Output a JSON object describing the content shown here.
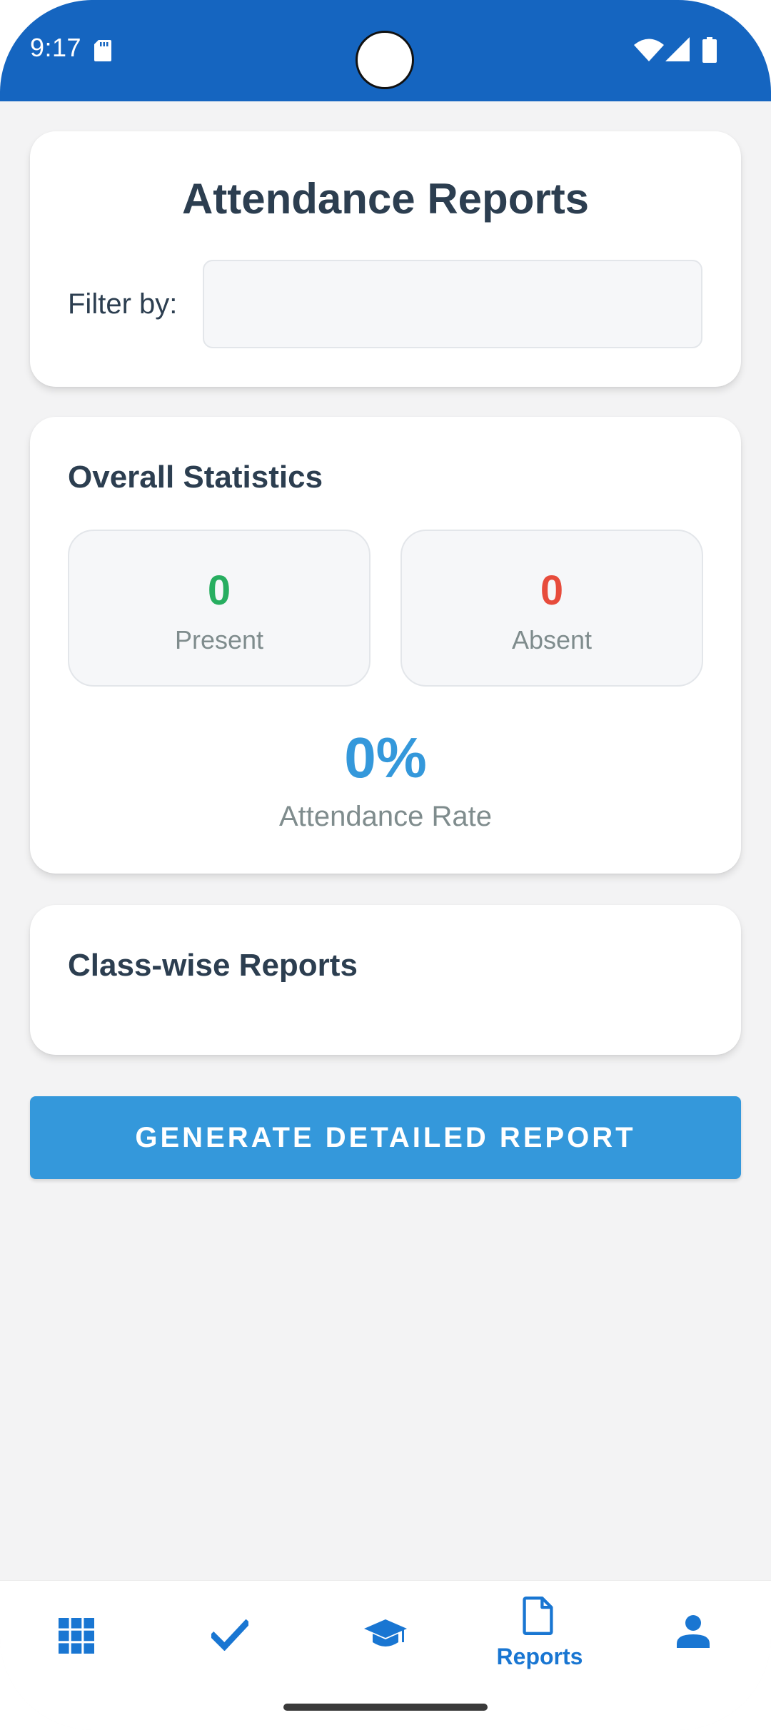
{
  "status_bar": {
    "time": "9:17",
    "background": "#1565c0",
    "icons": [
      "sd-card-icon",
      "camera-cutout",
      "wifi-icon",
      "cell-signal-icon",
      "battery-icon"
    ]
  },
  "header_card": {
    "title": "Attendance Reports",
    "filter_label": "Filter by:",
    "filter_value": ""
  },
  "stats_card": {
    "title": "Overall Statistics",
    "present": {
      "value": "0",
      "label": "Present",
      "color": "#27ae60"
    },
    "absent": {
      "value": "0",
      "label": "Absent",
      "color": "#e74c3c"
    },
    "rate": {
      "value": "0%",
      "label": "Attendance Rate",
      "color": "#3498db"
    }
  },
  "class_card": {
    "title": "Class-wise Reports"
  },
  "actions": {
    "generate_label": "GENERATE DETAILED REPORT",
    "color": "#3498db"
  },
  "bottom_nav": {
    "accent": "#1976d2",
    "items": [
      {
        "icon": "dashboard-grid-icon",
        "label": "",
        "active": false
      },
      {
        "icon": "checkmark-icon",
        "label": "",
        "active": false
      },
      {
        "icon": "graduation-cap-icon",
        "label": "",
        "active": false
      },
      {
        "icon": "document-icon",
        "label": "Reports",
        "active": true
      },
      {
        "icon": "person-icon",
        "label": "",
        "active": false
      }
    ]
  }
}
